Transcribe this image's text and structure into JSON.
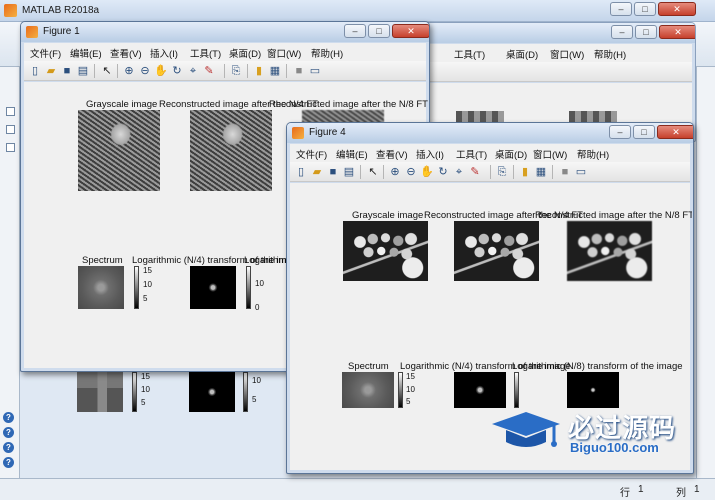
{
  "matlab": {
    "title": "MATLAB R2018a",
    "status": {
      "row_label": "行",
      "row_value": "1",
      "col_label": "列",
      "col_value": "1"
    },
    "left_panel_help": "?"
  },
  "figure1": {
    "title": "Figure 1",
    "menus": [
      "文件(F)",
      "编辑(E)",
      "查看(V)",
      "插入(I)",
      "工具(T)",
      "桌面(D)",
      "窗口(W)",
      "帮助(H)"
    ],
    "axes_titles": {
      "grayscale": "Grayscale image",
      "recon_n4": "Reconstructed image after the N/4 FT",
      "recon_n8": "Reconstructed image after the N/8 FT",
      "spectrum": "Spectrum",
      "log_n4": "Logarithmic (N/4) transform of the image",
      "log_n8": "Logarithmic (N/8) transform of the image"
    },
    "cbar1_ticks": [
      "15",
      "10",
      "5"
    ],
    "cbar2_ticks": [
      "10",
      "0"
    ]
  },
  "figure4": {
    "title": "Figure 4",
    "menus": [
      "文件(F)",
      "编辑(E)",
      "查看(V)",
      "插入(I)",
      "工具(T)",
      "桌面(D)",
      "窗口(W)",
      "帮助(H)"
    ],
    "axes_titles": {
      "grayscale": "Grayscale image",
      "recon_n4": "Reconstructed image after the N/4 FT",
      "recon_n8": "Reconstructed image after the N/8 FT",
      "spectrum": "Spectrum",
      "log_n4": "Logarithmic (N/4) transform of the image",
      "log_n8": "Logarithmic (N/8) transform of the image"
    },
    "cbar1_ticks": [
      "15",
      "10",
      "5"
    ],
    "cbar2_ticks": [
      "10",
      "0"
    ]
  },
  "back_figure": {
    "menus": [
      "工具(T)",
      "桌面(D)",
      "窗口(W)",
      "帮助(H)"
    ],
    "cbar_ticks": [
      "15",
      "10",
      "5"
    ],
    "cbar2_ticks": [
      "10",
      "5"
    ]
  },
  "watermark": {
    "main": "必过源码",
    "sub": "Biguo100.com"
  },
  "icons": [
    "new-file-icon",
    "open-icon",
    "save-icon",
    "print-icon",
    "pointer-icon",
    "zoom-in-icon",
    "zoom-out-icon",
    "pan-icon",
    "rotate-icon",
    "data-cursor-icon",
    "brush-icon",
    "link-icon",
    "colorbar-icon",
    "legend-icon",
    "hide-tools-icon",
    "dock-icon"
  ]
}
